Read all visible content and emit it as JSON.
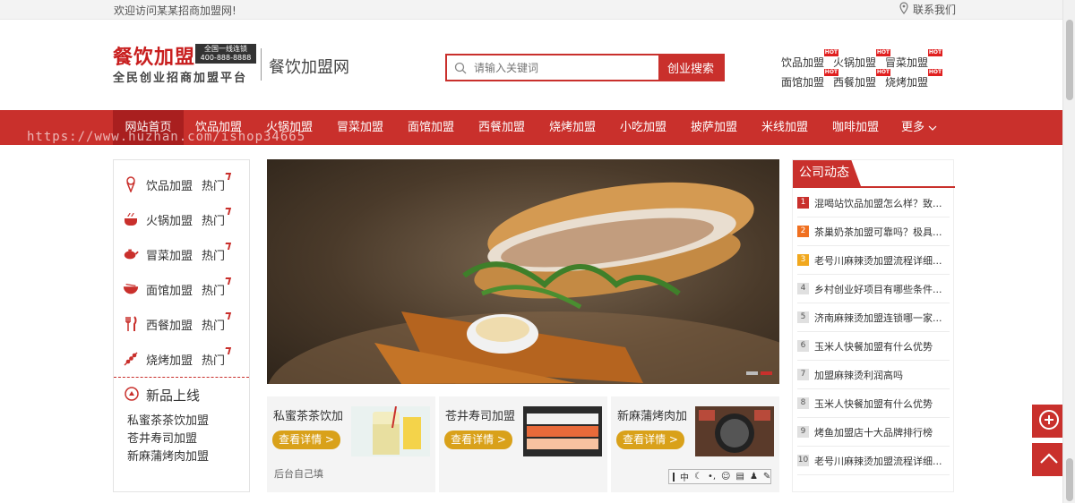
{
  "topbar": {
    "welcome": "欢迎访问某某招商加盟网!",
    "contact": "联系我们"
  },
  "header": {
    "logo_main": "餐饮加盟",
    "logo_box_line1": "全国一线连锁",
    "logo_box_line2": "400-888-8888",
    "logo_tagline": "全民创业招商加盟平台",
    "site_name": "餐饮加盟网",
    "search": {
      "placeholder": "请输入关键词",
      "button": "创业搜索"
    },
    "hotlinks": [
      {
        "label": "饮品加盟",
        "badge": "HOT"
      },
      {
        "label": "火锅加盟",
        "badge": "HOT"
      },
      {
        "label": "冒菜加盟",
        "badge": "HOT"
      },
      {
        "label": "面馆加盟",
        "badge": "HOT"
      },
      {
        "label": "西餐加盟",
        "badge": "HOT"
      },
      {
        "label": "烧烤加盟",
        "badge": "HOT"
      }
    ]
  },
  "nav": {
    "items": [
      "网站首页",
      "饮品加盟",
      "火锅加盟",
      "冒菜加盟",
      "面馆加盟",
      "西餐加盟",
      "烧烤加盟",
      "小吃加盟",
      "披萨加盟",
      "米线加盟",
      "咖啡加盟",
      "更多"
    ],
    "watermark": "https://www.huzhan.com/ishop34665"
  },
  "sidebar": {
    "categories": [
      {
        "label": "饮品加盟",
        "hot": "热门",
        "icon": "ice-cream-icon"
      },
      {
        "label": "火锅加盟",
        "hot": "热门",
        "icon": "hotpot-icon"
      },
      {
        "label": "冒菜加盟",
        "hot": "热门",
        "icon": "teapot-icon"
      },
      {
        "label": "面馆加盟",
        "hot": "热门",
        "icon": "bowl-icon"
      },
      {
        "label": "西餐加盟",
        "hot": "热门",
        "icon": "fork-knife-icon"
      },
      {
        "label": "烧烤加盟",
        "hot": "热门",
        "icon": "skewer-icon"
      }
    ],
    "new_title": "新品上线",
    "new_items": [
      "私蜜茶茶饮加盟",
      "苍井寿司加盟",
      "新麻蒲烤肉加盟"
    ]
  },
  "products": [
    {
      "title": "私蜜茶茶饮加",
      "button": "查看详情 >",
      "note": "后台自己填"
    },
    {
      "title": "苍井寿司加盟",
      "button": "查看详情 >",
      "note": ""
    },
    {
      "title": "新麻蒲烤肉加",
      "button": "查看详情 >",
      "note": ""
    }
  ],
  "ime": {
    "label": "中"
  },
  "news": {
    "title": "公司动态",
    "items": [
      {
        "num": "1",
        "text": "混喝站饮品加盟怎么样？致..."
      },
      {
        "num": "2",
        "text": "茶巢奶茶加盟可靠吗？极具..."
      },
      {
        "num": "3",
        "text": "老号川麻辣烫加盟流程详细..."
      },
      {
        "num": "4",
        "text": "乡村创业好项目有哪些条件..."
      },
      {
        "num": "5",
        "text": "济南麻辣烫加盟连锁哪一家..."
      },
      {
        "num": "6",
        "text": "玉米人快餐加盟有什么优势"
      },
      {
        "num": "7",
        "text": "加盟麻辣烫利润高吗"
      },
      {
        "num": "8",
        "text": "玉米人快餐加盟有什么优势"
      },
      {
        "num": "9",
        "text": "烤鱼加盟店十大品牌排行榜"
      },
      {
        "num": "10",
        "text": "老号川麻辣烫加盟流程详细..."
      }
    ]
  },
  "colors": {
    "brand": "#c9302c",
    "button": "#d9a11a"
  }
}
